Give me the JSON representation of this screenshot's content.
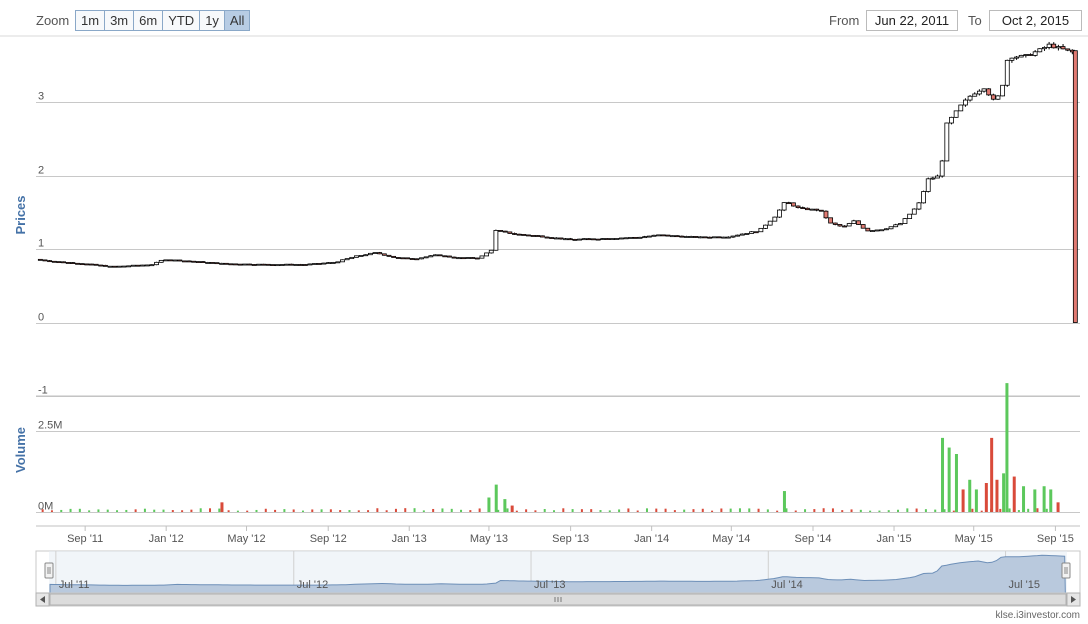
{
  "toolbar": {
    "zoom_label": "Zoom",
    "zoom_buttons": [
      "1m",
      "3m",
      "6m",
      "YTD",
      "1y",
      "All"
    ],
    "active_zoom": "All",
    "from_label": "From",
    "from_value": "Jun 22, 2011",
    "to_label": "To",
    "to_value": "Oct 2, 2015"
  },
  "footer": {
    "credit": "klse.i3investor.com"
  },
  "colors": {
    "up": "#ffffff",
    "down": "#e07a72",
    "vol_up": "#5cc85c",
    "vol_down": "#d94a3a",
    "navigator_fill": "#b9c9dd",
    "navigator_line": "#6d8fb8"
  },
  "chart_data": [
    {
      "type": "candlestick",
      "ylabel": "Prices",
      "ylim": [
        -1,
        3.9
      ],
      "yticks": [
        -1,
        0,
        1,
        2,
        3
      ],
      "x_range": [
        "2011-06-22",
        "2015-10-02"
      ],
      "x_ticks": [
        {
          "date": "2011-09-01",
          "label": "Sep '11"
        },
        {
          "date": "2012-01-01",
          "label": "Jan '12"
        },
        {
          "date": "2012-05-01",
          "label": "May '12"
        },
        {
          "date": "2012-09-01",
          "label": "Sep '12"
        },
        {
          "date": "2013-01-01",
          "label": "Jan '13"
        },
        {
          "date": "2013-05-01",
          "label": "May '13"
        },
        {
          "date": "2013-09-01",
          "label": "Sep '13"
        },
        {
          "date": "2014-01-01",
          "label": "Jan '14"
        },
        {
          "date": "2014-05-01",
          "label": "May '14"
        },
        {
          "date": "2014-09-01",
          "label": "Sep '14"
        },
        {
          "date": "2015-01-01",
          "label": "Jan '15"
        },
        {
          "date": "2015-05-01",
          "label": "May '15"
        },
        {
          "date": "2015-09-01",
          "label": "Sep '15"
        }
      ],
      "price_path": [
        [
          "2011-06-22",
          0.86
        ],
        [
          "2011-07-20",
          0.83
        ],
        [
          "2011-09-01",
          0.8
        ],
        [
          "2011-10-15",
          0.76
        ],
        [
          "2011-12-15",
          0.79
        ],
        [
          "2012-01-01",
          0.86
        ],
        [
          "2012-02-15",
          0.83
        ],
        [
          "2012-04-01",
          0.8
        ],
        [
          "2012-06-01",
          0.79
        ],
        [
          "2012-08-01",
          0.79
        ],
        [
          "2012-09-15",
          0.82
        ],
        [
          "2012-10-15",
          0.9
        ],
        [
          "2012-11-15",
          0.95
        ],
        [
          "2012-12-15",
          0.88
        ],
        [
          "2013-01-15",
          0.87
        ],
        [
          "2013-02-15",
          0.92
        ],
        [
          "2013-03-15",
          0.88
        ],
        [
          "2013-04-20",
          0.88
        ],
        [
          "2013-05-10",
          1.0
        ],
        [
          "2013-05-15",
          1.25
        ],
        [
          "2013-06-15",
          1.2
        ],
        [
          "2013-07-15",
          1.18
        ],
        [
          "2013-09-01",
          1.13
        ],
        [
          "2013-10-15",
          1.14
        ],
        [
          "2013-12-15",
          1.16
        ],
        [
          "2014-01-15",
          1.19
        ],
        [
          "2014-03-15",
          1.16
        ],
        [
          "2014-05-01",
          1.17
        ],
        [
          "2014-06-15",
          1.25
        ],
        [
          "2014-07-10",
          1.45
        ],
        [
          "2014-07-25",
          1.65
        ],
        [
          "2014-08-15",
          1.55
        ],
        [
          "2014-09-15",
          1.53
        ],
        [
          "2014-10-01",
          1.35
        ],
        [
          "2014-10-20",
          1.3
        ],
        [
          "2014-11-05",
          1.38
        ],
        [
          "2014-11-25",
          1.25
        ],
        [
          "2014-12-20",
          1.27
        ],
        [
          "2015-01-15",
          1.35
        ],
        [
          "2015-02-10",
          1.6
        ],
        [
          "2015-02-25",
          1.95
        ],
        [
          "2015-03-15",
          2.0
        ],
        [
          "2015-03-25",
          2.7
        ],
        [
          "2015-04-15",
          2.95
        ],
        [
          "2015-05-01",
          3.1
        ],
        [
          "2015-05-20",
          3.2
        ],
        [
          "2015-06-05",
          3.0
        ],
        [
          "2015-06-15",
          3.15
        ],
        [
          "2015-06-25",
          3.62
        ],
        [
          "2015-07-20",
          3.62
        ],
        [
          "2015-08-15",
          3.72
        ],
        [
          "2015-08-25",
          3.78
        ],
        [
          "2015-09-15",
          3.72
        ],
        [
          "2015-09-28",
          3.68
        ]
      ],
      "last_candle": {
        "date": "2015-10-01",
        "open": 3.7,
        "high": 3.7,
        "low": 0.0,
        "close": 0.0
      }
    },
    {
      "type": "bar",
      "ylabel": "Volume",
      "ylim": [
        0,
        3.6
      ],
      "yticks": [
        {
          "value": 0,
          "label": "0M"
        },
        {
          "value": 2.5,
          "label": "2.5M"
        }
      ],
      "units": "M",
      "notable_bars": [
        {
          "date": "2012-03-25",
          "value": 0.3,
          "dir": "down"
        },
        {
          "date": "2013-05-01",
          "value": 0.45,
          "dir": "up"
        },
        {
          "date": "2013-05-12",
          "value": 0.85,
          "dir": "up"
        },
        {
          "date": "2013-05-25",
          "value": 0.4,
          "dir": "up"
        },
        {
          "date": "2013-06-05",
          "value": 0.2,
          "dir": "down"
        },
        {
          "date": "2014-07-20",
          "value": 0.65,
          "dir": "up"
        },
        {
          "date": "2015-03-15",
          "value": 2.3,
          "dir": "up"
        },
        {
          "date": "2015-03-25",
          "value": 2.0,
          "dir": "up"
        },
        {
          "date": "2015-04-05",
          "value": 1.8,
          "dir": "up"
        },
        {
          "date": "2015-04-15",
          "value": 0.7,
          "dir": "down"
        },
        {
          "date": "2015-04-25",
          "value": 1.0,
          "dir": "up"
        },
        {
          "date": "2015-05-05",
          "value": 0.7,
          "dir": "up"
        },
        {
          "date": "2015-05-20",
          "value": 0.9,
          "dir": "down"
        },
        {
          "date": "2015-05-28",
          "value": 2.3,
          "dir": "down"
        },
        {
          "date": "2015-06-05",
          "value": 1.0,
          "dir": "down"
        },
        {
          "date": "2015-06-15",
          "value": 1.2,
          "dir": "up"
        },
        {
          "date": "2015-06-20",
          "value": 4.0,
          "dir": "up"
        },
        {
          "date": "2015-07-01",
          "value": 1.1,
          "dir": "down"
        },
        {
          "date": "2015-07-15",
          "value": 0.8,
          "dir": "up"
        },
        {
          "date": "2015-08-01",
          "value": 0.7,
          "dir": "up"
        },
        {
          "date": "2015-08-15",
          "value": 0.8,
          "dir": "up"
        },
        {
          "date": "2015-08-25",
          "value": 0.7,
          "dir": "up"
        },
        {
          "date": "2015-09-05",
          "value": 0.3,
          "dir": "down"
        }
      ]
    },
    {
      "type": "area",
      "role": "navigator",
      "x_ticks": [
        {
          "date": "2011-07-01",
          "label": "Jul '11"
        },
        {
          "date": "2012-07-01",
          "label": "Jul '12"
        },
        {
          "date": "2013-07-01",
          "label": "Jul '13"
        },
        {
          "date": "2014-07-01",
          "label": "Jul '14"
        },
        {
          "date": "2015-07-01",
          "label": "Jul '15"
        }
      ]
    }
  ]
}
